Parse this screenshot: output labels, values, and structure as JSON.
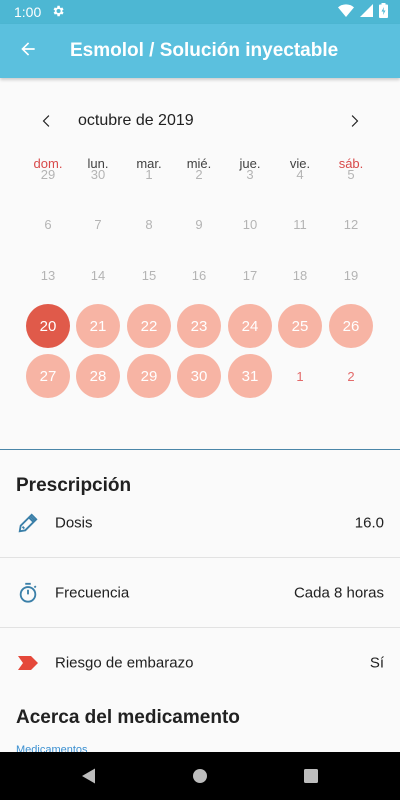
{
  "status_bar": {
    "time": "1:00",
    "icons": [
      "gear-icon",
      "wifi-icon",
      "signal-icon",
      "battery-icon"
    ]
  },
  "app_bar": {
    "title": "Esmolol / Solución inyectable",
    "back_icon": "arrow-left-icon",
    "color": "#5bc0de"
  },
  "calendar": {
    "month_label": "octubre de 2019",
    "prev_icon": "chevron-left-icon",
    "next_icon": "chevron-right-icon",
    "weekdays": [
      "dom.",
      "lun.",
      "mar.",
      "mié.",
      "jue.",
      "vie.",
      "sáb."
    ],
    "weeks": [
      [
        {
          "day": "29",
          "state": "other"
        },
        {
          "day": "30",
          "state": "other"
        },
        {
          "day": "1",
          "state": "plain"
        },
        {
          "day": "2",
          "state": "plain"
        },
        {
          "day": "3",
          "state": "plain"
        },
        {
          "day": "4",
          "state": "plain"
        },
        {
          "day": "5",
          "state": "plain"
        }
      ],
      [
        {
          "day": "6",
          "state": "plain"
        },
        {
          "day": "7",
          "state": "plain"
        },
        {
          "day": "8",
          "state": "plain"
        },
        {
          "day": "9",
          "state": "plain"
        },
        {
          "day": "10",
          "state": "plain"
        },
        {
          "day": "11",
          "state": "plain"
        },
        {
          "day": "12",
          "state": "plain"
        }
      ],
      [
        {
          "day": "13",
          "state": "plain"
        },
        {
          "day": "14",
          "state": "plain"
        },
        {
          "day": "15",
          "state": "plain"
        },
        {
          "day": "16",
          "state": "plain"
        },
        {
          "day": "17",
          "state": "plain"
        },
        {
          "day": "18",
          "state": "plain"
        },
        {
          "day": "19",
          "state": "plain"
        }
      ],
      [
        {
          "day": "20",
          "state": "selected"
        },
        {
          "day": "21",
          "state": "marked"
        },
        {
          "day": "22",
          "state": "marked"
        },
        {
          "day": "23",
          "state": "marked"
        },
        {
          "day": "24",
          "state": "marked"
        },
        {
          "day": "25",
          "state": "marked"
        },
        {
          "day": "26",
          "state": "marked"
        }
      ],
      [
        {
          "day": "27",
          "state": "marked"
        },
        {
          "day": "28",
          "state": "marked"
        },
        {
          "day": "29",
          "state": "marked"
        },
        {
          "day": "30",
          "state": "marked"
        },
        {
          "day": "31",
          "state": "marked"
        },
        {
          "day": "1",
          "state": "next"
        },
        {
          "day": "2",
          "state": "next"
        }
      ]
    ],
    "colors": {
      "selected": "#e05a4a",
      "marked": "#f7b4a4",
      "weekend_label": "#d84a4a"
    }
  },
  "prescription": {
    "title": "Prescripción",
    "rows": [
      {
        "icon": "dropper-icon",
        "label": "Dosis",
        "value": "16.0"
      },
      {
        "icon": "stopwatch-icon",
        "label": "Frecuencia",
        "value": "Cada 8 horas"
      },
      {
        "icon": "tag-chevron-icon",
        "label": "Riesgo de embarazo",
        "value": "Sí"
      }
    ]
  },
  "about": {
    "title": "Acerca del medicamento",
    "link": "Medicamentos"
  },
  "nav_bar": {
    "icons": [
      "back-triangle-icon",
      "home-circle-icon",
      "recents-square-icon"
    ]
  }
}
